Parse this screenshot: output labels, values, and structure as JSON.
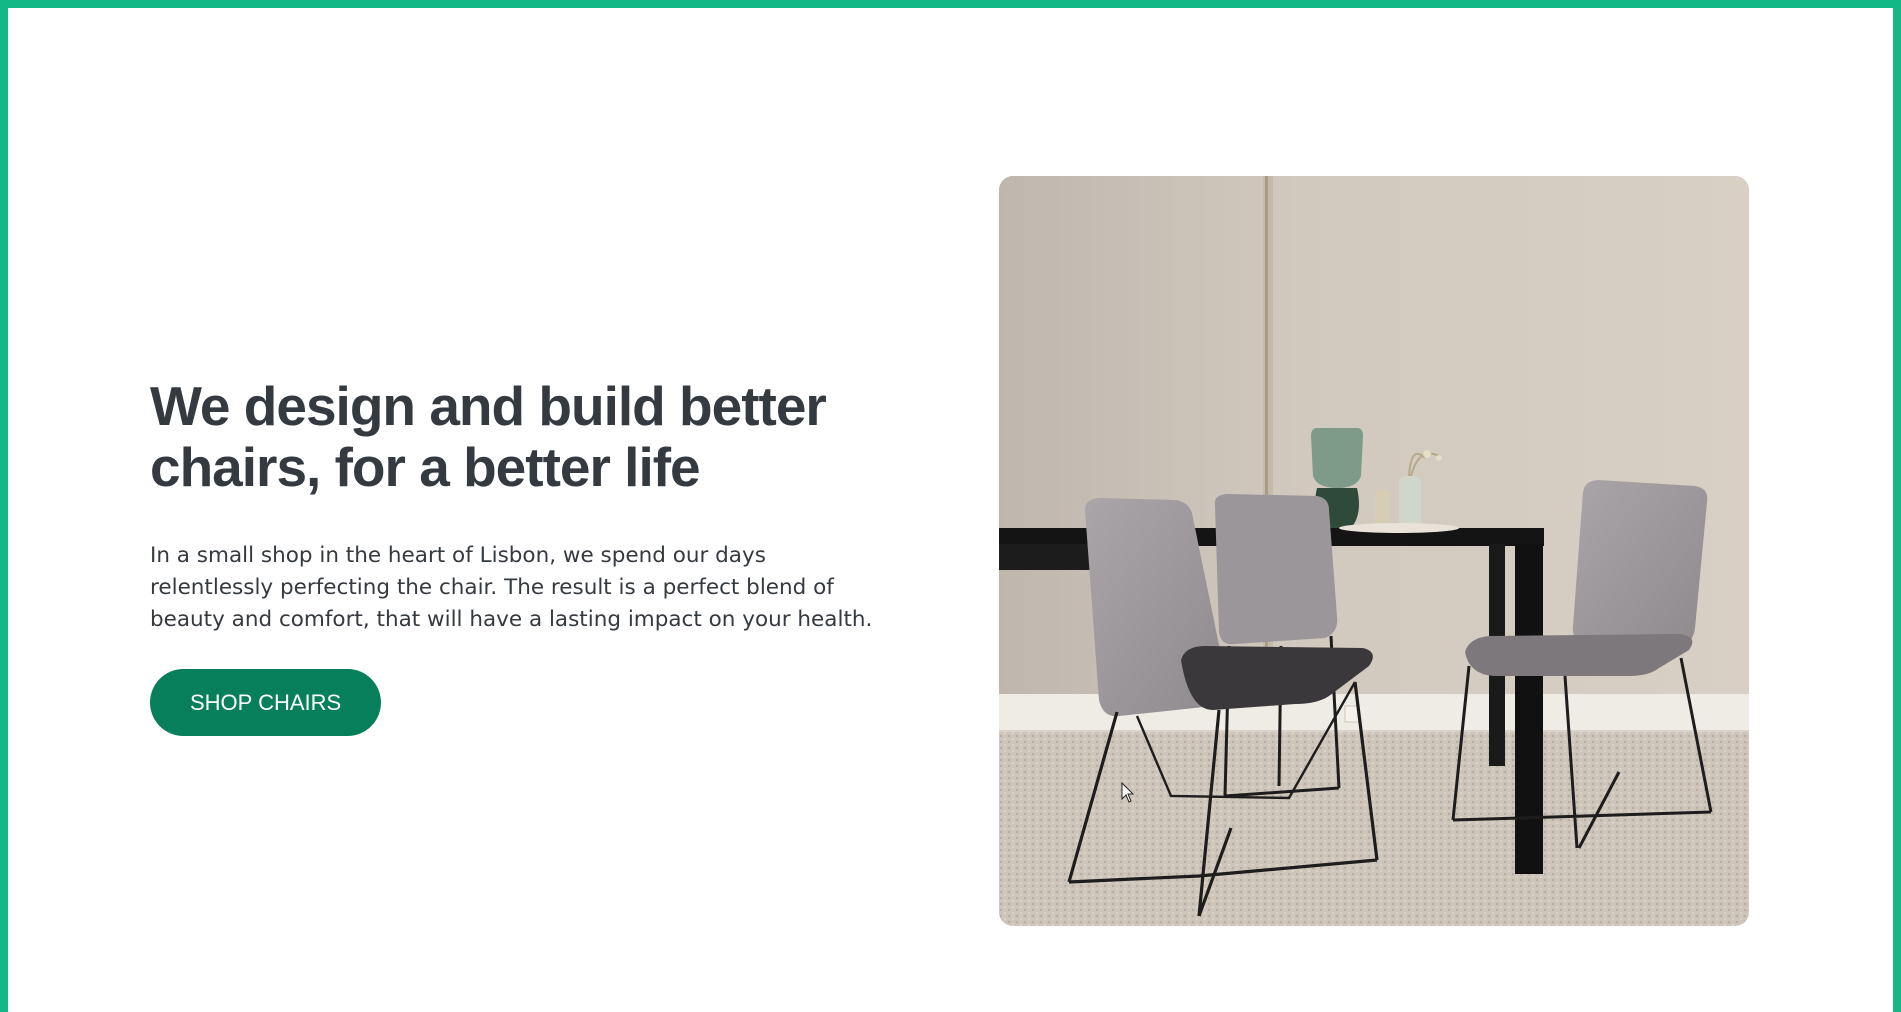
{
  "hero": {
    "title": "We design and build better chairs, for a better life",
    "description": "In a small shop in the heart of Lisbon, we spend our days relentlessly perfecting the chair. The result is a perfect blend of beauty and comfort, that will have a lasting impact on your health.",
    "cta_label": "SHOP CHAIRS"
  },
  "colors": {
    "frame_border": "#12b886",
    "cta_background": "#087f5b",
    "heading_text": "#343a40"
  },
  "image": {
    "subject": "chairs-around-black-dining-table-photo"
  }
}
